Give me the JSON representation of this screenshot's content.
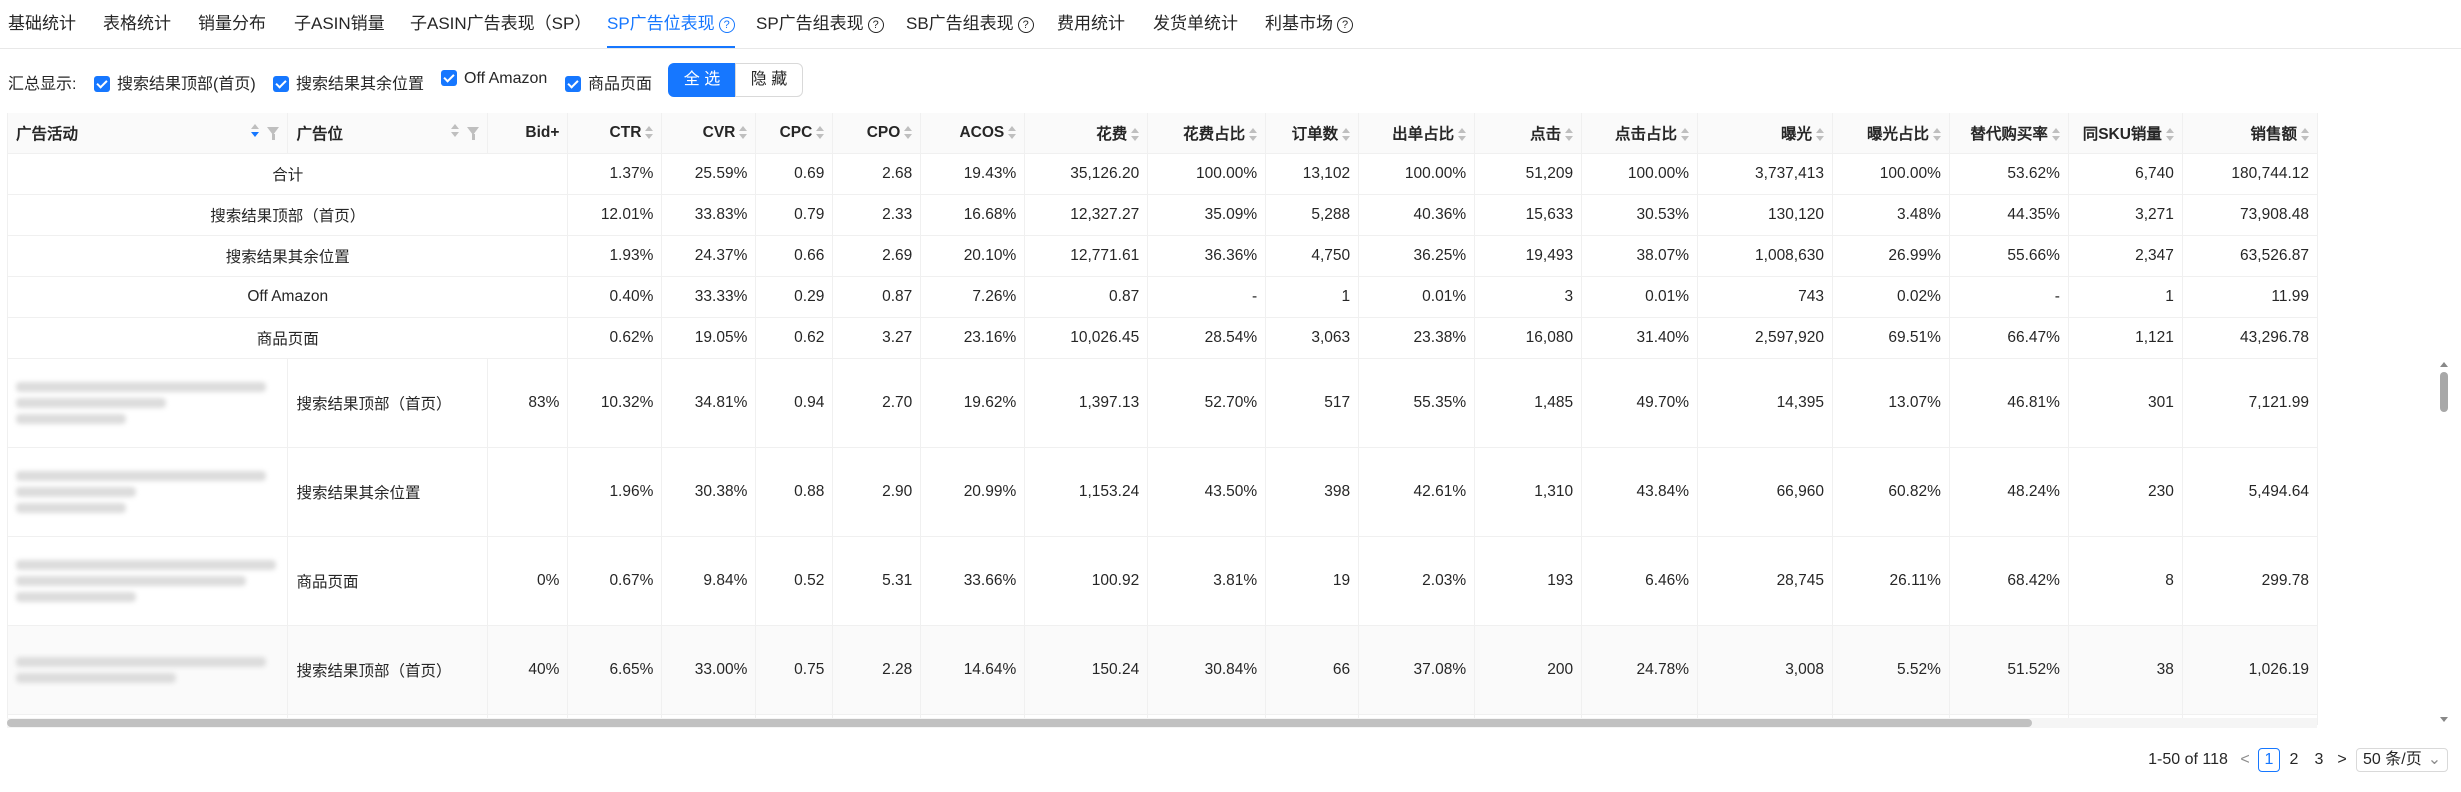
{
  "tabs": [
    {
      "label": "基础统计",
      "help": false
    },
    {
      "label": "表格统计",
      "help": false
    },
    {
      "label": "销量分布",
      "help": false
    },
    {
      "label": "子ASIN销量",
      "help": false
    },
    {
      "label": "子ASIN广告表现（SP）",
      "help": false
    },
    {
      "label": "SP广告位表现",
      "help": true,
      "active": true
    },
    {
      "label": "SP广告组表现",
      "help": true
    },
    {
      "label": "SB广告组表现",
      "help": true
    },
    {
      "label": "费用统计",
      "help": false
    },
    {
      "label": "发货单统计",
      "help": false
    },
    {
      "label": "利基市场",
      "help": true
    }
  ],
  "filters": {
    "label": "汇总显示:",
    "options": [
      "搜索结果顶部(首页)",
      "搜索结果其余位置",
      "Off Amazon",
      "商品页面"
    ],
    "select_all": "全 选",
    "hide": "隐 藏"
  },
  "columns": [
    "广告活动",
    "广告位",
    "Bid+",
    "CTR",
    "CVR",
    "CPC",
    "CPO",
    "ACOS",
    "花费",
    "花费占比",
    "订单数",
    "出单占比",
    "点击",
    "点击占比",
    "曝光",
    "曝光占比",
    "替代购买率",
    "同SKU销量",
    "销售额"
  ],
  "summary_rows": [
    {
      "label": "合计",
      "v": [
        "1.37%",
        "25.59%",
        "0.69",
        "2.68",
        "19.43%",
        "35,126.20",
        "100.00%",
        "13,102",
        "100.00%",
        "51,209",
        "100.00%",
        "3,737,413",
        "100.00%",
        "53.62%",
        "6,740",
        "180,744.12"
      ]
    },
    {
      "label": "搜索结果顶部（首页）",
      "v": [
        "12.01%",
        "33.83%",
        "0.79",
        "2.33",
        "16.68%",
        "12,327.27",
        "35.09%",
        "5,288",
        "40.36%",
        "15,633",
        "30.53%",
        "130,120",
        "3.48%",
        "44.35%",
        "3,271",
        "73,908.48"
      ]
    },
    {
      "label": "搜索结果其余位置",
      "v": [
        "1.93%",
        "24.37%",
        "0.66",
        "2.69",
        "20.10%",
        "12,771.61",
        "36.36%",
        "4,750",
        "36.25%",
        "19,493",
        "38.07%",
        "1,008,630",
        "26.99%",
        "55.66%",
        "2,347",
        "63,526.87"
      ]
    },
    {
      "label": "Off Amazon",
      "v": [
        "0.40%",
        "33.33%",
        "0.29",
        "0.87",
        "7.26%",
        "0.87",
        "-",
        "1",
        "0.01%",
        "3",
        "0.01%",
        "743",
        "0.02%",
        "-",
        "1",
        "11.99"
      ]
    },
    {
      "label": "商品页面",
      "v": [
        "0.62%",
        "19.05%",
        "0.62",
        "3.27",
        "23.16%",
        "10,026.45",
        "28.54%",
        "3,063",
        "23.38%",
        "16,080",
        "31.40%",
        "2,597,920",
        "69.51%",
        "66.47%",
        "1,121",
        "43,296.78"
      ]
    }
  ],
  "detail_rows": [
    {
      "placement": "搜索结果顶部（首页）",
      "bid": "83%",
      "v": [
        "10.32%",
        "34.81%",
        "0.94",
        "2.70",
        "19.62%",
        "1,397.13",
        "52.70%",
        "517",
        "55.35%",
        "1,485",
        "49.70%",
        "14,395",
        "13.07%",
        "46.81%",
        "301",
        "7,121.99"
      ]
    },
    {
      "placement": "搜索结果其余位置",
      "bid": "",
      "v": [
        "1.96%",
        "30.38%",
        "0.88",
        "2.90",
        "20.99%",
        "1,153.24",
        "43.50%",
        "398",
        "42.61%",
        "1,310",
        "43.84%",
        "66,960",
        "60.82%",
        "48.24%",
        "230",
        "5,494.64"
      ]
    },
    {
      "placement": "商品页面",
      "bid": "0%",
      "v": [
        "0.67%",
        "9.84%",
        "0.52",
        "5.31",
        "33.66%",
        "100.92",
        "3.81%",
        "19",
        "2.03%",
        "193",
        "6.46%",
        "28,745",
        "26.11%",
        "68.42%",
        "8",
        "299.78"
      ]
    },
    {
      "placement": "搜索结果顶部（首页）",
      "bid": "40%",
      "v": [
        "6.65%",
        "33.00%",
        "0.75",
        "2.28",
        "14.64%",
        "150.24",
        "30.84%",
        "66",
        "37.08%",
        "200",
        "24.78%",
        "3,008",
        "5.52%",
        "51.52%",
        "38",
        "1,026.19"
      ]
    }
  ],
  "pagination": {
    "range": "1-50 of 118",
    "pages": [
      "1",
      "2",
      "3"
    ],
    "current": "1",
    "page_size": "50 条/页"
  }
}
